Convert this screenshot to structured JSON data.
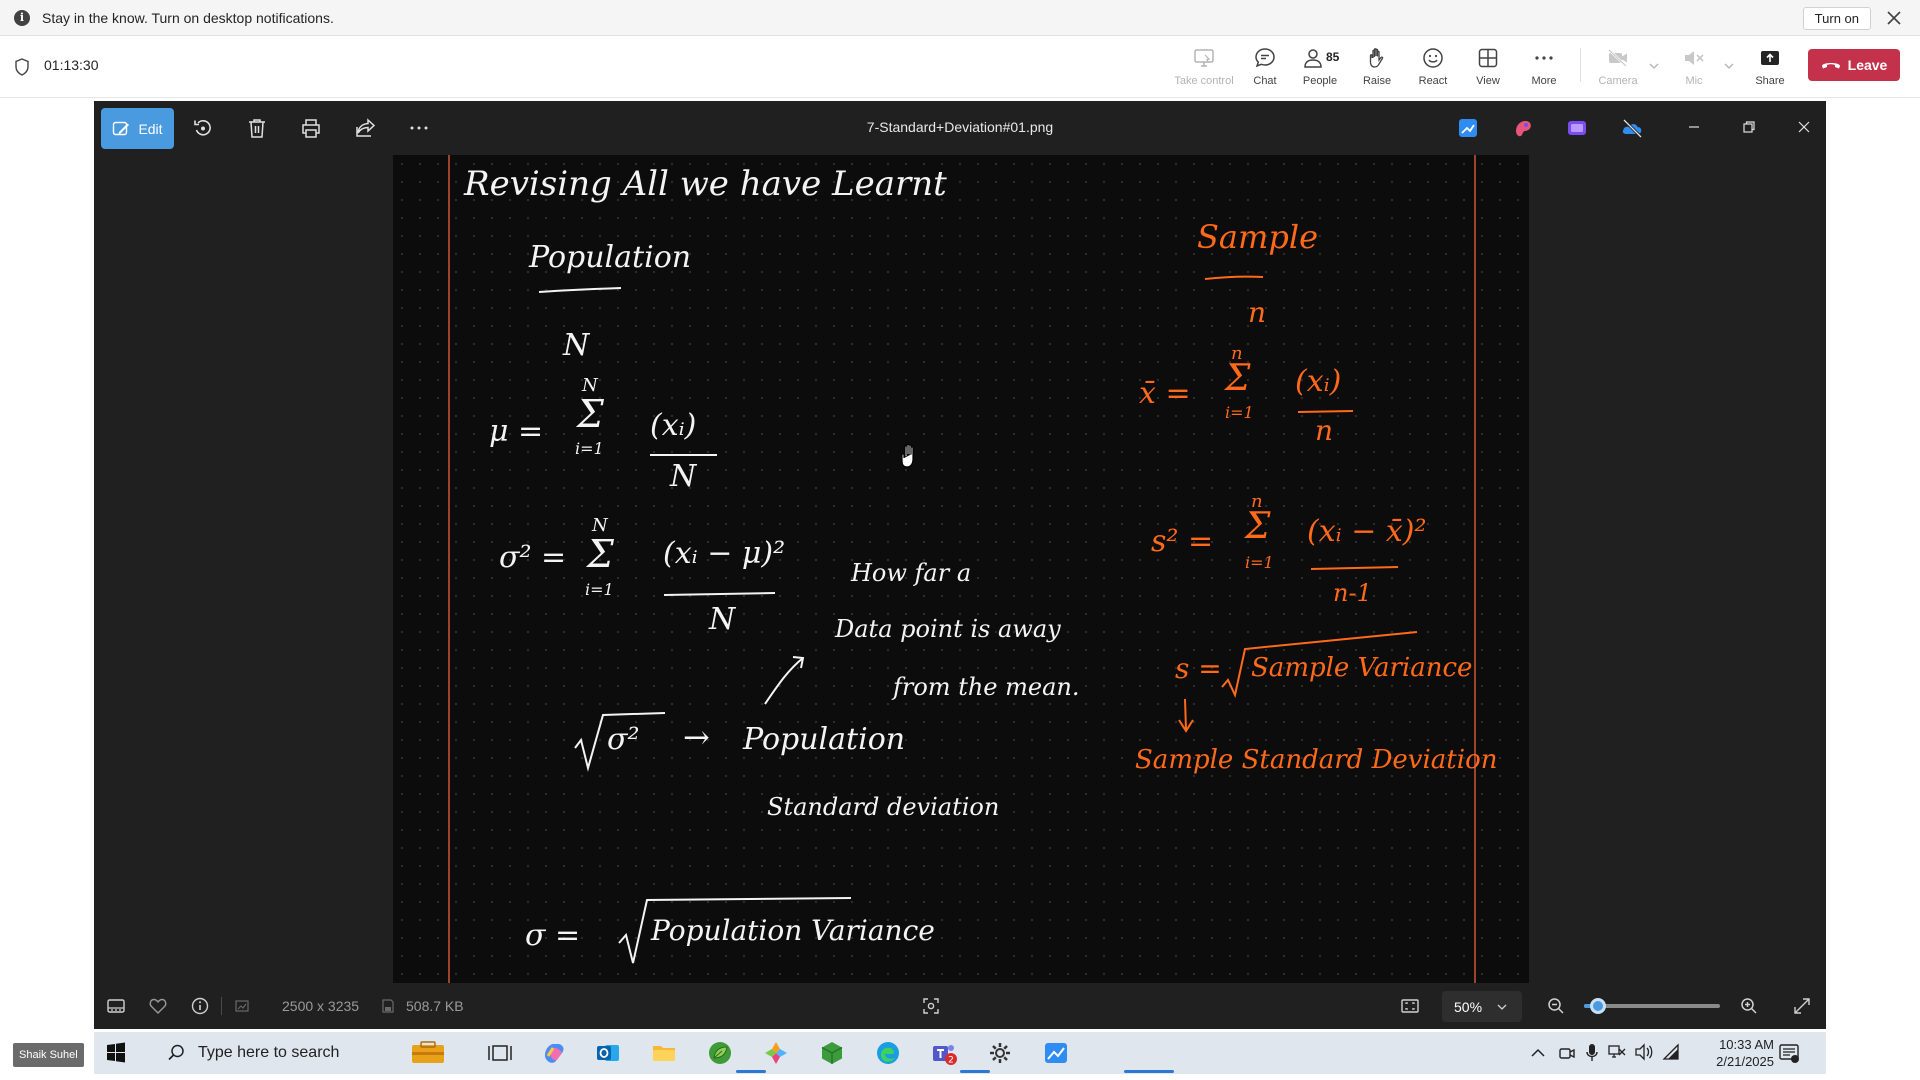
{
  "notification": {
    "message": "Stay in the know. Turn on desktop notifications.",
    "turn_on_label": "Turn on"
  },
  "meeting": {
    "timer": "01:13:30",
    "take_control_label": "Take control",
    "chat_label": "Chat",
    "people_label": "People",
    "people_count": "85",
    "raise_label": "Raise",
    "react_label": "React",
    "view_label": "View",
    "more_label": "More",
    "camera_label": "Camera",
    "mic_label": "Mic",
    "share_label": "Share",
    "leave_label": "Leave"
  },
  "photos": {
    "edit_label": "Edit",
    "file_title": "7-Standard+Deviation#01.png",
    "dimensions": "2500 x 3235",
    "file_size": "508.7 KB",
    "zoom": "50%",
    "zoom_slider_fraction": 0.1
  },
  "whiteboard": {
    "heading": "Revising All we have Learnt",
    "population": "Population",
    "pop_N": "N",
    "mu_lhs": "μ =",
    "sum_top_N": "N",
    "sum_bottom_i1": "i=1",
    "mu_numer": "(xᵢ)",
    "mu_denom": "N",
    "var_lhs": "σ² =",
    "var_numer": "(xᵢ − μ)²",
    "var_denom": "N",
    "how_far": "How far a",
    "data_point": "Data point  is  away",
    "from_mean": "from  the  mean.",
    "sqrt_sigma": "√σ²",
    "arrow": "→",
    "population2": "Population",
    "std_dev": "Standard deviation",
    "sigma_eq": "σ =",
    "pop_variance": "Population Variance",
    "sample": "Sample",
    "sample_n": "n",
    "xbar_lhs": "x̄ =",
    "sample_sum_top": "n",
    "sample_sum_bottom": "i=1",
    "xbar_numer": "(xᵢ)",
    "xbar_denom": "n",
    "s2_lhs": "s² =",
    "s2_numer": "(xᵢ − x̄)²",
    "s2_denom": "n-1",
    "s_lhs": "s =",
    "sample_variance": "Sample Variance",
    "sample_std": "Sample Standard Deviation"
  },
  "taskbar": {
    "user_label": "Shaik Suhel",
    "search_placeholder": "Type here to search",
    "teams_badge": "2",
    "time": "10:33 AM",
    "date": "2/21/2025"
  },
  "colors": {
    "leave_red": "#c4314b",
    "edit_blue": "#4a9ae0",
    "ink_white": "#f4f4f4",
    "ink_orange": "#ff6a1a"
  }
}
